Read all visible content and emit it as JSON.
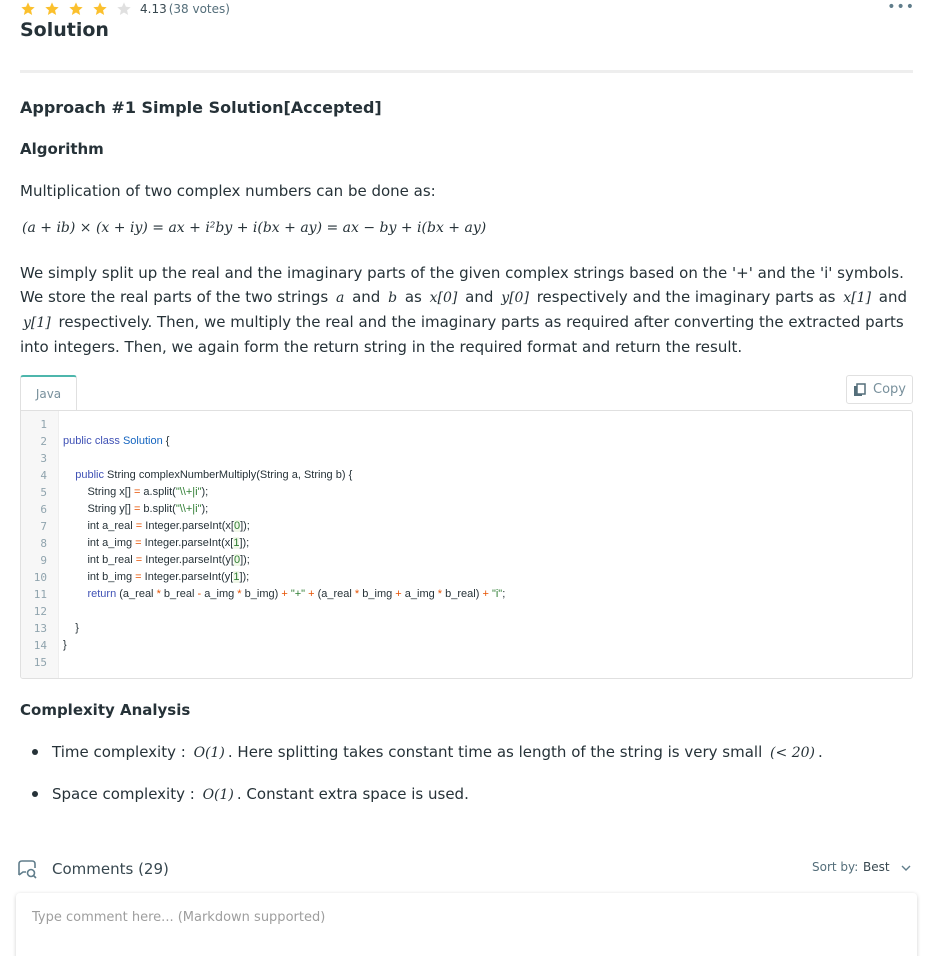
{
  "rating": {
    "stars_filled": 4,
    "stars_total": 5,
    "value": "4.13",
    "votes": "(38 votes)",
    "filled_color": "#fbc02d",
    "empty_color": "#e0e0e0"
  },
  "header": {
    "more_icon": "more-horizontal-icon",
    "title": "Solution"
  },
  "approach": {
    "title": "Approach #1 Simple Solution[Accepted]"
  },
  "algorithm": {
    "title": "Algorithm",
    "intro": "Multiplication of two complex numbers can be done as:",
    "formula": "(a + ib) × (x + iy) = ax + i²by + i(bx + ay) = ax − by + i(bx + ay)",
    "explain_1": "We simply split up the real and the imaginary parts of the given complex strings based on the '+' and the 'i' symbols. We store the real parts of the two strings",
    "math_a": "a",
    "and_1": "and",
    "math_b": "b",
    "as_1": "as",
    "math_x0": "x[0]",
    "and_2": "and",
    "math_y0": "y[0]",
    "explain_2": "respectively and the imaginary parts as",
    "math_x1": "x[1]",
    "and_3": "and",
    "math_y1": "y[1]",
    "explain_3": "respectively. Then, we multiply the real and the imaginary parts as required after converting the extracted parts into integers. Then, we again form the return string in the required format and return the result."
  },
  "code": {
    "tab": "Java",
    "copy_label": "Copy",
    "line_numbers": [
      "1",
      "2",
      "3",
      "4",
      "5",
      "6",
      "7",
      "8",
      "9",
      "10",
      "11",
      "12",
      "13",
      "14",
      "15"
    ],
    "t": {
      "public": "public",
      "class": "class",
      "Solution": "Solution",
      "lbrace": " {",
      "String": "String",
      "method": " complexNumberMultiply(",
      "args_a": " a, ",
      "args_b": " b) {",
      "x_decl": " x[] ",
      "eq": "=",
      "a_split": " a.split(",
      "regex": "\"\\\\+|i\"",
      "close": ");",
      "y_decl": " y[] ",
      "b_split": " b.split(",
      "int": "int",
      "a_real": " a_real ",
      "a_img": " a_img ",
      "b_real": " b_real ",
      "b_img": " b_img ",
      "parse_x": " Integer.parseInt(x[",
      "parse_y": " Integer.parseInt(y[",
      "zero": "0",
      "one": "1",
      "close2": "]);",
      "return": "return",
      "r1": " (a_real ",
      "star": "*",
      "r2": " b_real ",
      "minus": "-",
      "r3": " a_img ",
      "r4": " b_img) ",
      "plus": "+",
      "plus_str": "\"+\"",
      "r5": " (a_real ",
      "r6": " b_img ",
      "r7": " a_img ",
      "r8": " b_real) ",
      "i_str": "\"i\"",
      "semi": ";",
      "rbrace": "}"
    }
  },
  "complexity": {
    "title": "Complexity Analysis",
    "time_label": "Time complexity :",
    "time_math": "O(1)",
    "time_text": ". Here splitting takes constant time as length of the string is very small",
    "time_math2": "(< 20)",
    "time_end": ".",
    "space_label": "Space complexity :",
    "space_math": "O(1)",
    "space_text": ". Constant extra space is used."
  },
  "comments": {
    "icon": "comment-search-icon",
    "label": "Comments (29)",
    "sort_label": "Sort by:",
    "sort_value": "Best",
    "placeholder": "Type comment here... (Markdown supported)"
  }
}
